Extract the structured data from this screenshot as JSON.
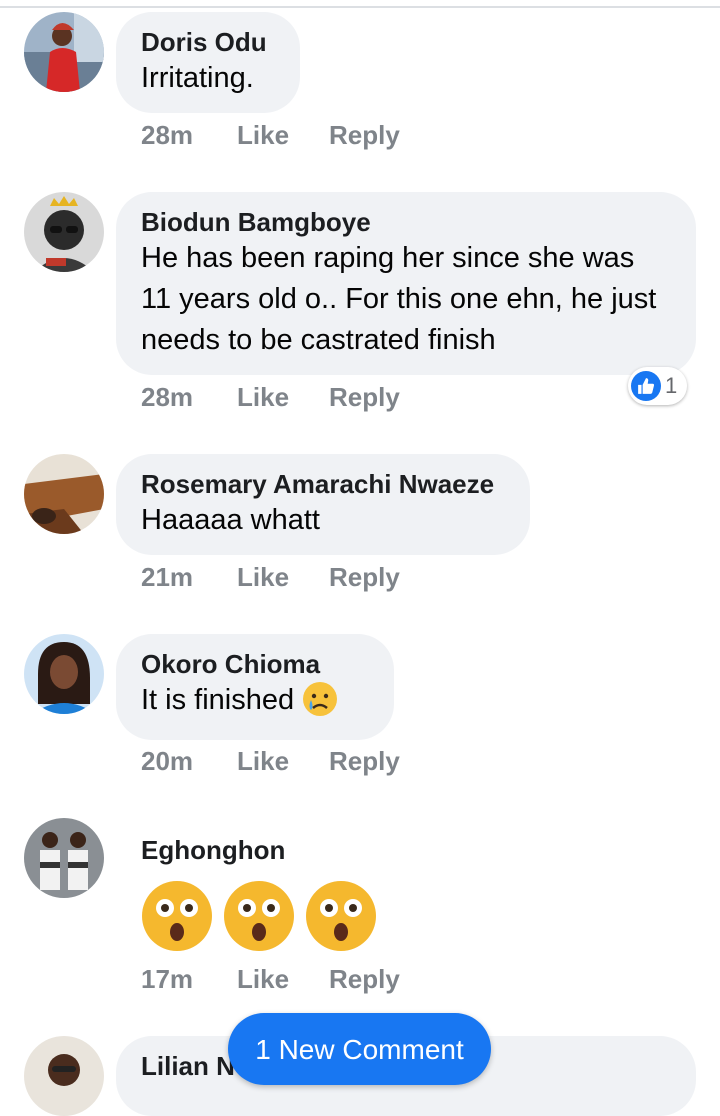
{
  "actions": {
    "like_label": "Like",
    "reply_label": "Reply"
  },
  "comments": [
    {
      "author": "Doris Odu",
      "text": "Irritating.",
      "time": "28m"
    },
    {
      "author": "Biodun Bamgboye",
      "text": "He has been raping her since she was 11 years old o.. For this one ehn, he just needs to be castrated finish",
      "time": "28m",
      "reaction_count": "1"
    },
    {
      "author": "Rosemary Amarachi Nwaeze",
      "text": "Haaaaa whatt",
      "time": "21m"
    },
    {
      "author": "Okoro Chioma",
      "text": "It is finished",
      "emoji": "crying-face",
      "time": "20m"
    },
    {
      "author": "Eghonghon",
      "emoji": "astonished-face x3",
      "time": "17m"
    },
    {
      "author": "Lilian N"
    }
  ],
  "new_comment_label": "1 New Comment",
  "colors": {
    "accent": "#1877f2",
    "bubble": "#f0f2f5",
    "meta": "#7f848a"
  }
}
